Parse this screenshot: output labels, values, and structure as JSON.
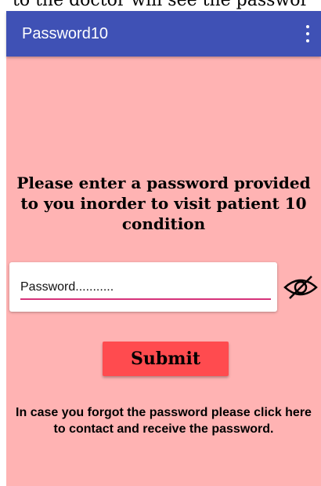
{
  "top_caption": "to the doctor will see the passwor",
  "app_bar": {
    "title": "Password10",
    "overflow_icon": "more-vert-icon"
  },
  "main": {
    "instruction": "Please enter a password provided to you inorder to visit patient 10 condition",
    "password_field": {
      "placeholder": "Password...........",
      "value": ""
    },
    "visibility_icon": "eye-off-icon",
    "submit_label": "Submit",
    "forgot_text": "In case you forgot the password please click here to contact and receive the password."
  },
  "colors": {
    "app_bar": "#3f51b5",
    "background": "#ffb3b3",
    "submit_button": "#ff4b4f",
    "input_underline": "#d6337a"
  }
}
